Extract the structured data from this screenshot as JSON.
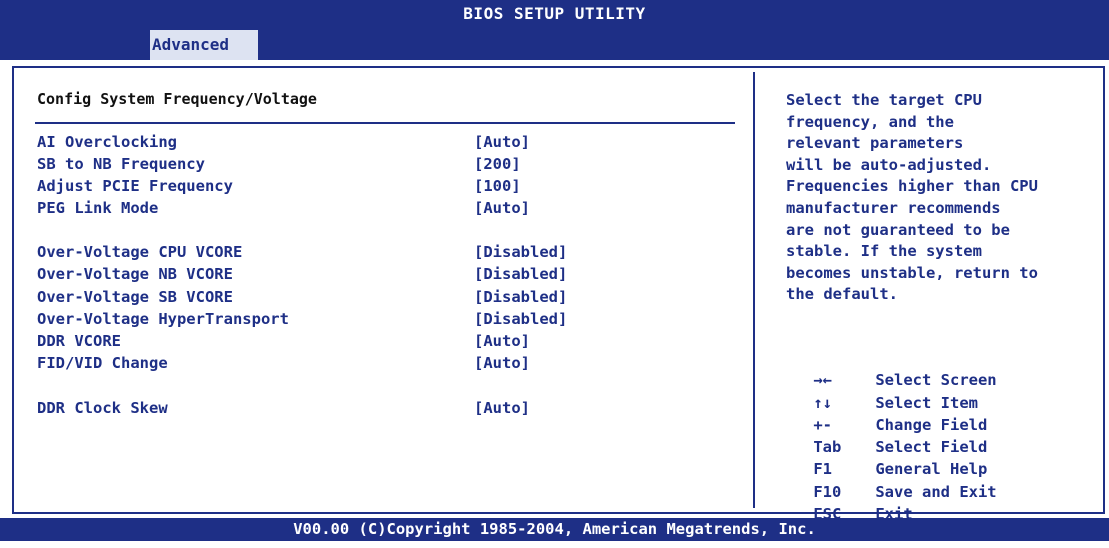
{
  "header": {
    "title": "BIOS SETUP UTILITY",
    "active_tab": "Advanced"
  },
  "main": {
    "section_title": "Config System Frequency/Voltage",
    "settings": [
      {
        "label": "AI Overclocking",
        "value": "[Auto]"
      },
      {
        "label": "SB to NB Frequency",
        "value": "[200]"
      },
      {
        "label": "Adjust PCIE Frequency",
        "value": "[100]"
      },
      {
        "label": "PEG Link Mode",
        "value": "[Auto]"
      },
      {
        "label": "Over-Voltage CPU VCORE",
        "value": "[Disabled]"
      },
      {
        "label": "Over-Voltage NB VCORE",
        "value": "[Disabled]"
      },
      {
        "label": "Over-Voltage SB VCORE",
        "value": "[Disabled]"
      },
      {
        "label": "Over-Voltage HyperTransport",
        "value": "[Disabled]"
      },
      {
        "label": "DDR VCORE",
        "value": "[Auto]"
      },
      {
        "label": "FID/VID Change",
        "value": "[Auto]"
      },
      {
        "label": "DDR Clock Skew",
        "value": "[Auto]"
      }
    ]
  },
  "help": {
    "text": "Select the target CPU\nfrequency, and the\nrelevant parameters\nwill be auto-adjusted.\nFrequencies higher than CPU\nmanufacturer recommends\nare not guaranteed to be\nstable. If the system\nbecomes unstable, return to\nthe default.",
    "keys": [
      {
        "key": "→←",
        "action": "Select Screen"
      },
      {
        "key": "↑↓",
        "action": "Select Item"
      },
      {
        "key": "+-",
        "action": "Change Field"
      },
      {
        "key": "Tab",
        "action": "Select Field"
      },
      {
        "key": "F1",
        "action": "General Help"
      },
      {
        "key": "F10",
        "action": "Save and Exit"
      },
      {
        "key": "ESC",
        "action": "Exit"
      }
    ]
  },
  "footer": {
    "text": "V00.00 (C)Copyright 1985-2004, American Megatrends, Inc."
  },
  "colors": {
    "primary": "#1e2f86",
    "tab_bg": "#dde3f2",
    "background": "#ffffff"
  }
}
